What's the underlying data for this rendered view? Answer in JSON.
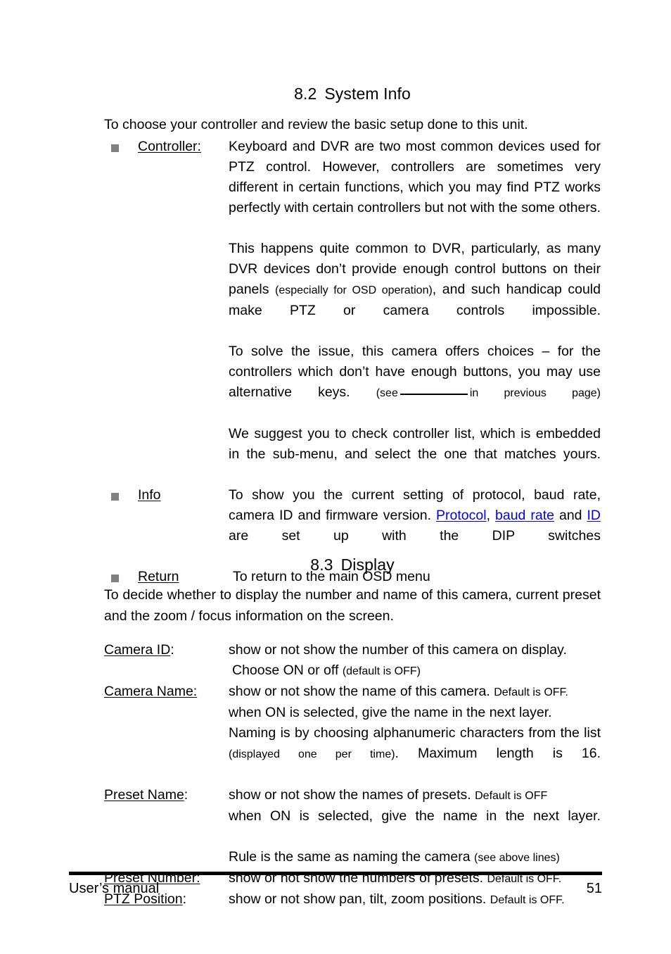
{
  "document": {
    "footer_left": "User’s manual",
    "page_number": "51"
  },
  "link_color": "#0000EE",
  "bullet_color": "#808080",
  "section_system_info": {
    "number": "8.2",
    "title": "System Info",
    "intro": "To choose your controller and review the basic setup done to this unit.",
    "items": [
      {
        "term": "Controller:",
        "paragraphs": [
          "Keyboard and DVR are two most common devices used for PTZ control. However, controllers are sometimes very different in certain functions, which you may find PTZ works perfectly with certain controllers but not with the some others.",
          "This happens quite common to DVR, particularly, as many DVR devices don’t provide enough control buttons on their panels (especially for OSD operation), and such handicap could make PTZ or camera controls impossible.",
          "To solve the issue, this camera offers choices – for the controllers which don’t have enough buttons, you may use alternative keys. (see ____________ in previous page)",
          "We suggest you to check controller list, which is embedded in the sub-menu, and select the one that matches yours."
        ],
        "fragments": {
          "p1": "Keyboard and DVR are two most common devices used for PTZ control. However, controllers are sometimes very different in certain functions, which you may find PTZ works perfectly with certain controllers but not with the some others.",
          "p2_a": "This happens quite common to DVR, particularly, as many DVR devices don’t provide enough control buttons on their panels ",
          "p2_small": "(especially for OSD operation)",
          "p2_b": ", and such handicap could make PTZ or camera controls impossible.",
          "p3_a": "To solve the issue, this camera offers choices – for the controllers which don’t have enough buttons, you may use alternative keys. ",
          "p3_small_open": "(see",
          "p3_small_close": "in previous page)",
          "p4": "We suggest you to check controller list, which is embedded in the sub-menu, and select the one that matches yours."
        }
      },
      {
        "term": "Info",
        "fragments": {
          "a": "To show you the current setting of protocol, baud rate, camera ID and firmware version. ",
          "link1": "Protocol",
          "sep1": ", ",
          "link2": "baud rate",
          "mid": " and ",
          "link3": "ID",
          "b": " are set up with the DIP switches"
        }
      },
      {
        "term": "Return",
        "fragments": {
          "a": "To return to the main OSD menu"
        }
      }
    ]
  },
  "section_display": {
    "number": "8.3",
    "title": "Display",
    "intro": "To decide whether to display the number and name of this camera, current preset and the zoom / focus information on the screen.",
    "rows": [
      {
        "term": "Camera ID",
        "term_underlined": "Camera ID",
        "term_tail": ":",
        "lines": [
          {
            "text": "show or not show the number of this camera on display."
          },
          {
            "text": "Choose ON or off ",
            "small": "(default is OFF)"
          }
        ]
      },
      {
        "term": "Camera Name:",
        "term_underlined": "Camera Name:",
        "term_tail": "",
        "lines": [
          {
            "text": "show or not show the name of this camera. ",
            "small": "Default is OFF."
          },
          {
            "text": " when ON is selected, give the name in the next layer."
          },
          {
            "text": " Naming is by choosing alphanumeric characters from the list ",
            "small": "(displayed one per time)",
            "text_after": ". Maximum length is 16."
          }
        ]
      },
      {
        "term": "Preset Name:",
        "term_underlined": "Preset Name",
        "term_tail": ":",
        "lines": [
          {
            "text": "show or not show the names of presets. ",
            "small": "Default is OFF"
          },
          {
            "text": " when ON is selected, give the name in the next layer."
          },
          {
            "text": " Rule is the same as naming the camera ",
            "small": "(see above lines)"
          }
        ]
      },
      {
        "term": "Preset Number:",
        "term_underlined": "Preset Number:",
        "term_tail": "",
        "lines": [
          {
            "text": "show or not show the numbers of presets. ",
            "small": "Default is OFF."
          }
        ]
      },
      {
        "term": "PTZ Position:",
        "term_underlined": "PTZ Position",
        "term_tail": ":",
        "lines": [
          {
            "text": "show or not show pan, tilt, zoom positions. ",
            "small": "Default is OFF."
          }
        ]
      }
    ]
  }
}
